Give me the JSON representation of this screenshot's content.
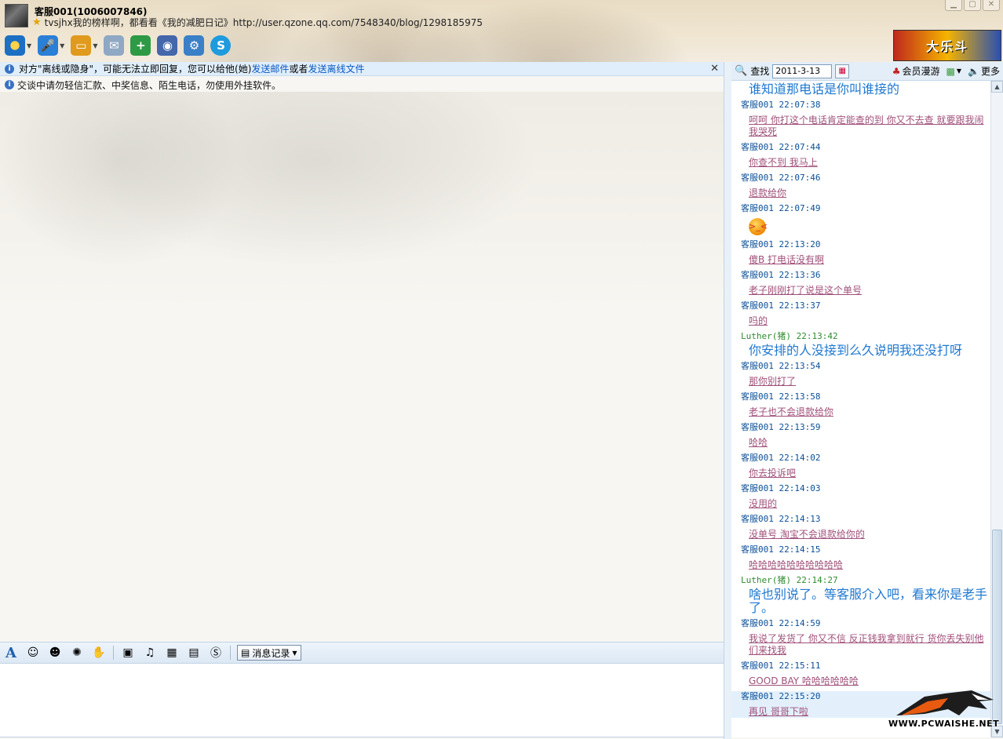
{
  "window": {
    "contact_name": "客服001(1006007846)",
    "signature": "tvsjhx我的榜样啊，都看看《我的减肥日记》http://user.qzone.qq.com/7548340/blog/1298185975",
    "controls": [
      "minimize-icon",
      "maximize-icon",
      "close-icon"
    ]
  },
  "toolbar": {
    "buttons": [
      {
        "name": "video-chat",
        "icon": "camera-icon",
        "color": "#1d6fc4"
      },
      {
        "name": "voice-chat",
        "icon": "microphone-icon",
        "color": "#2a7fd6"
      },
      {
        "name": "send-file",
        "icon": "folder-icon",
        "color": "#e09a1e"
      },
      {
        "name": "send-sms",
        "icon": "envelope-icon",
        "color": "#6b8fb5"
      },
      {
        "name": "create-group",
        "icon": "add-group-icon",
        "color": "#2e9a45"
      },
      {
        "name": "remote-assist",
        "icon": "remote-icon",
        "color": "#4466aa"
      },
      {
        "name": "app-settings",
        "icon": "gear-icon",
        "color": "#3a7fc8"
      },
      {
        "name": "soso",
        "icon": "soso-icon",
        "color": "#1e9bdc"
      }
    ]
  },
  "ad_banner": {
    "text": "大乐斗"
  },
  "notice": {
    "text": "对方\"离线或隐身\"，可能无法立即回复，您可以给他(她)",
    "link_mail": "发送邮件",
    "joiner": "或者",
    "link_file": "发送离线文件"
  },
  "warning": {
    "text": "交谈中请勿轻信汇款、中奖信息、陌生电话，勿使用外挂软件。"
  },
  "input_toolbar": {
    "icons": [
      "font-icon",
      "smiley-icon",
      "magic-face-icon",
      "shake-icon",
      "gift-icon",
      "image-icon",
      "music-icon",
      "gift-box-icon",
      "screenshot-icon",
      "soso-icon"
    ],
    "history_label": "消息记录"
  },
  "history_bar": {
    "search_label": "查找",
    "date_value": "2011-3-13",
    "member_label": "会员漫游",
    "more_label": "更多"
  },
  "messages": [
    {
      "head": "",
      "body": "谁知道那电话是你叫谁接的",
      "style": "big"
    },
    {
      "head": "客服001  22:07:38",
      "body": "呵呵 你打这个电话肯定能查的到 你又不去查 就要跟我闹 我哭死",
      "style": "pink"
    },
    {
      "head": "客服001  22:07:44",
      "body": "你查不到 我马上",
      "style": "pink"
    },
    {
      "head": "客服001  22:07:46",
      "body": "退款给你",
      "style": "pink"
    },
    {
      "head": "客服001  22:07:49",
      "body": "",
      "style": "emoji"
    },
    {
      "head": "客服001  22:13:20",
      "body": "傻B 打电话没有啊",
      "style": "pink"
    },
    {
      "head": "客服001  22:13:36",
      "body": "老子刚刚打了说是这个单号",
      "style": "pink"
    },
    {
      "head": "客服001  22:13:37",
      "body": "吗的",
      "style": "pink"
    },
    {
      "head": "Luther(猪) 22:13:42",
      "body": "你安排的人没接到么久说明我还没打呀",
      "style": "big",
      "other": true
    },
    {
      "head": "客服001  22:13:54",
      "body": "那你别打了",
      "style": "pink"
    },
    {
      "head": "客服001  22:13:58",
      "body": "老子也不会退款给你",
      "style": "pink"
    },
    {
      "head": "客服001  22:13:59",
      "body": "哈哈",
      "style": "pink"
    },
    {
      "head": "客服001  22:14:02",
      "body": "你去投诉吧",
      "style": "pink"
    },
    {
      "head": "客服001  22:14:03",
      "body": "没用的",
      "style": "pink"
    },
    {
      "head": "客服001  22:14:13",
      "body": "没单号 淘宝不会退款给你的",
      "style": "pink"
    },
    {
      "head": "客服001  22:14:15",
      "body": "哈哈哈哈哈哈哈哈哈哈",
      "style": "pink"
    },
    {
      "head": "Luther(猪) 22:14:27",
      "body": "啥也别说了。等客服介入吧，看来你是老手了。",
      "style": "big",
      "other": true
    },
    {
      "head": "客服001  22:14:59",
      "body": "我说了发货了 你又不信 反正钱我拿到就行 货你丢失别他们来找我",
      "style": "pink"
    },
    {
      "head": "客服001  22:15:11",
      "body": "GOOD BAY  哈哈哈哈哈哈",
      "style": "pink"
    },
    {
      "head": "客服001  22:15:20",
      "body": "再见 哥哥下啦",
      "style": "pink",
      "highlight": true
    }
  ],
  "watermark": {
    "text": "WWW.PCWAISHE.NET"
  }
}
